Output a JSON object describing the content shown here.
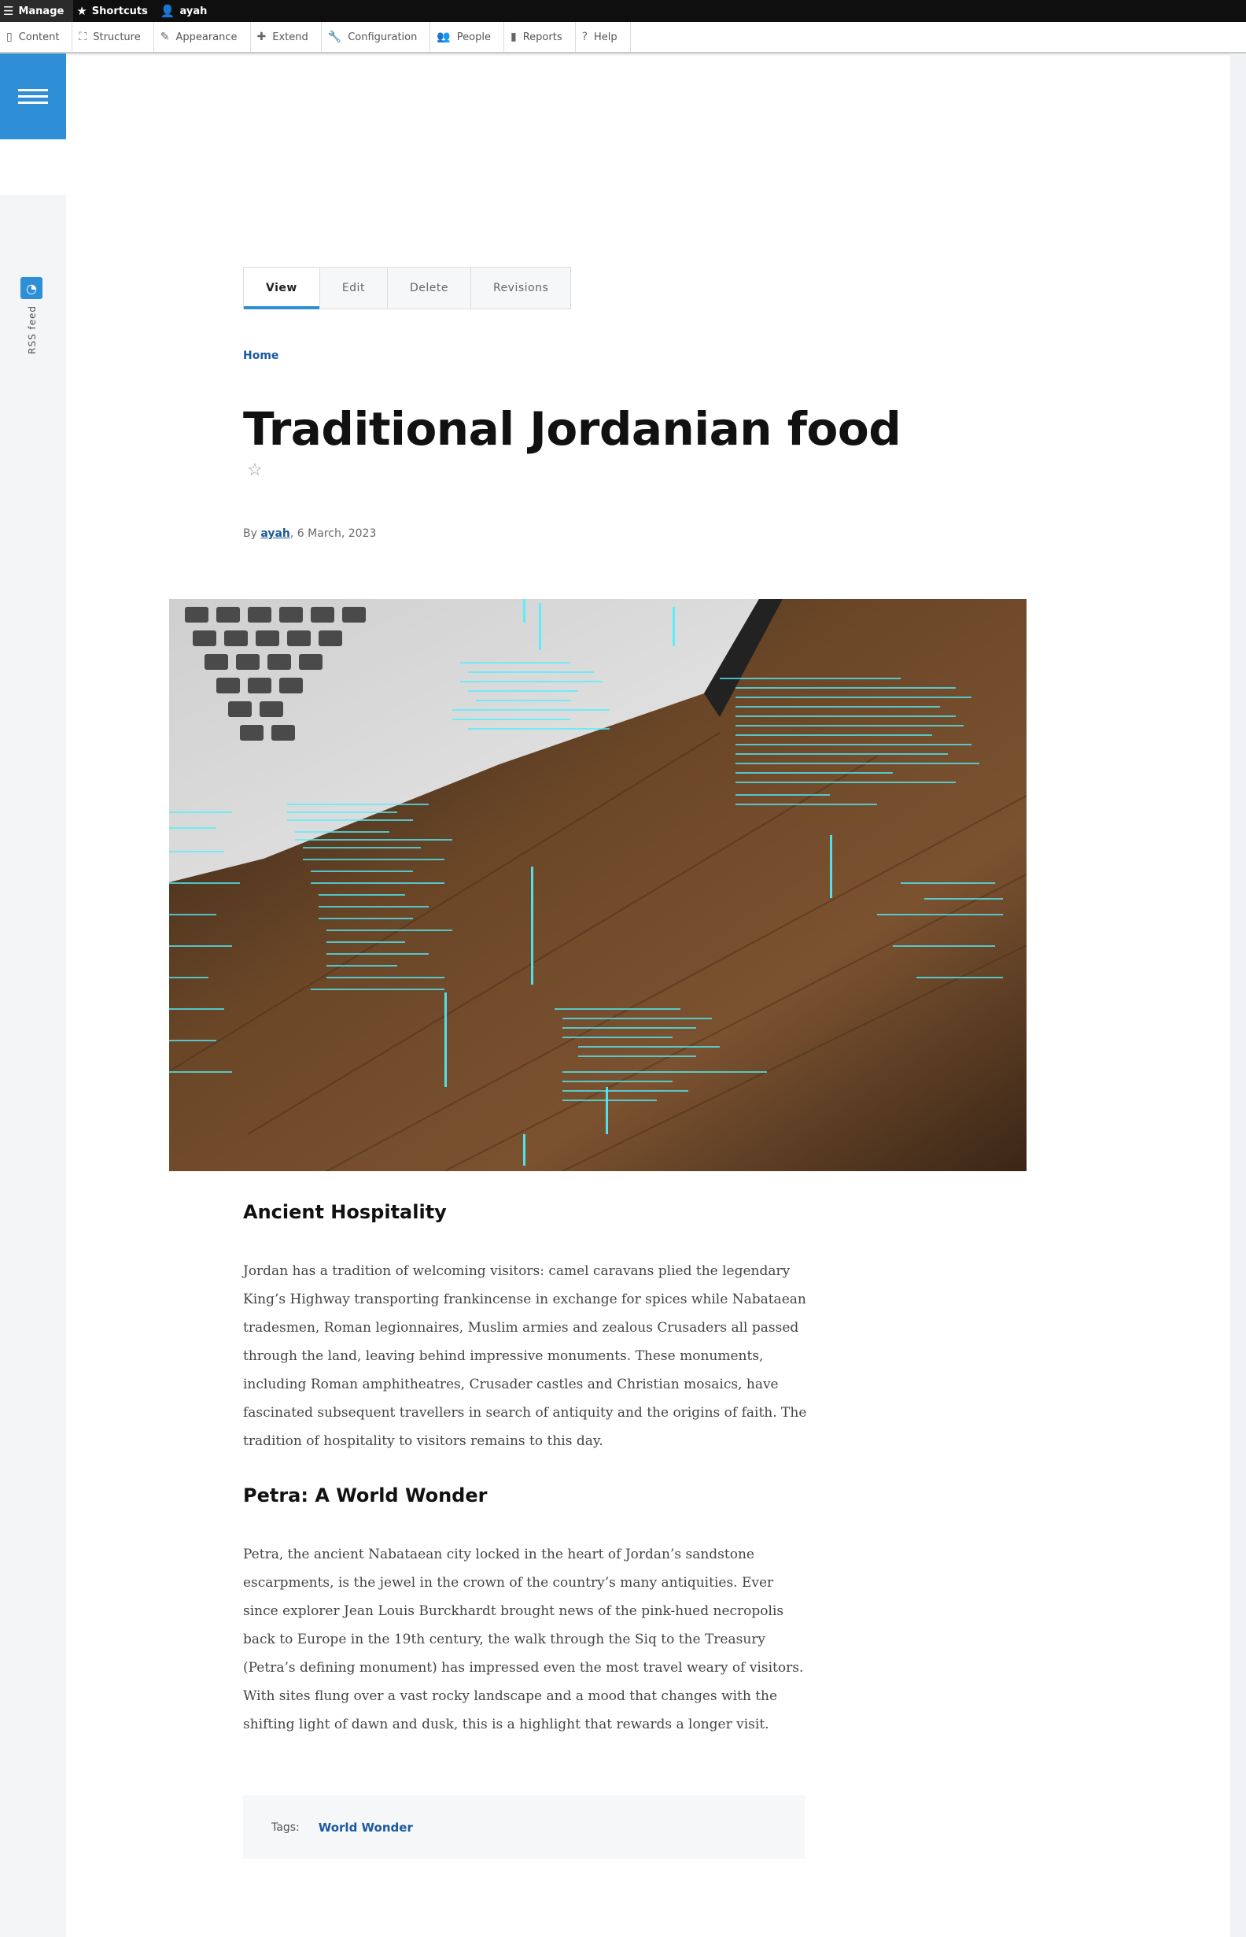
{
  "toolbar": {
    "manage": "Manage",
    "shortcuts": "Shortcuts",
    "user": "ayah"
  },
  "tray": {
    "items": [
      "Content",
      "Structure",
      "Appearance",
      "Extend",
      "Configuration",
      "People",
      "Reports",
      "Help"
    ]
  },
  "sidebar": {
    "rss_label": "RSS feed"
  },
  "tabs": [
    "View",
    "Edit",
    "Delete",
    "Revisions"
  ],
  "breadcrumb": "Home",
  "article": {
    "title": "Traditional Jordanian food",
    "byline_prefix": "By",
    "author": "ayah",
    "date": ", 6 March, 2023",
    "sections": [
      {
        "heading": "Ancient Hospitality",
        "body": "Jordan has a tradition of welcoming visitors: camel caravans plied the legendary King’s Highway transporting frankincense in exchange for spices while Nabataean tradesmen, Roman legionnaires, Muslim armies and zealous Crusaders all passed through the land, leaving behind impressive monuments. These monuments, including Roman amphitheatres, Crusader castles and Christian mosaics, have fascinated subsequent travellers in search of antiquity and the origins of faith. The tradition of hospitality to visitors remains to this day."
      },
      {
        "heading": "Petra: A World Wonder",
        "body": "Petra, the ancient Nabataean city locked in the heart of Jordan’s sandstone escarpments, is the jewel in the crown of the country’s many antiquities. Ever since explorer Jean Louis Burckhardt brought news of the pink-hued necropolis back to Europe in the 19th century, the walk through the Siq to the Treasury (Petra’s defining monument) has impressed even the most travel weary of visitors. With sites flung over a vast rocky landscape and a mood that changes with the shifting light of dawn and dusk, this is a highlight that rewards a longer visit."
      }
    ],
    "tags_label": "Tags:",
    "tag": "World Wonder"
  },
  "colors": {
    "accent": "#2e8fd6",
    "link": "#1b5aa0",
    "toolbar": "#0f0f0f"
  }
}
